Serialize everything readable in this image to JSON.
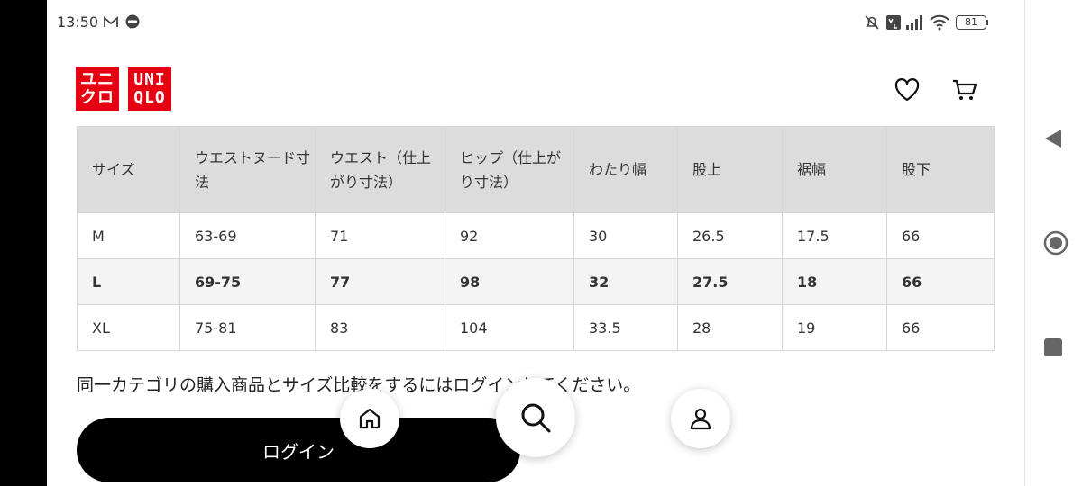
{
  "status_bar": {
    "time": "13:50",
    "battery": "81"
  },
  "brand": {
    "logo_left": [
      "ユニ",
      "クロ"
    ],
    "logo_right": [
      "UNI",
      "QLO"
    ],
    "color": "#e60012"
  },
  "icons": {
    "favorite": "heart-icon",
    "cart": "cart-icon",
    "home": "home-icon",
    "search": "search-icon",
    "account": "user-icon",
    "back": "triangle-back-icon",
    "home_nav": "circle-home-icon",
    "recents": "square-recents-icon"
  },
  "size_table": {
    "headers": [
      "サイズ",
      "ウエストヌード寸法",
      "ウエスト（仕上がり寸法）",
      "ヒップ（仕上がり寸法）",
      "わたり幅",
      "股上",
      "裾幅",
      "股下"
    ],
    "rows": [
      [
        "M",
        "63-69",
        "71",
        "92",
        "30",
        "26.5",
        "17.5",
        "66"
      ],
      [
        "L",
        "69-75",
        "77",
        "98",
        "32",
        "27.5",
        "18",
        "66"
      ],
      [
        "XL",
        "75-81",
        "83",
        "104",
        "33.5",
        "28",
        "19",
        "66"
      ]
    ]
  },
  "note": "同一カテゴリの購入商品とサイズ比較をするにはログインしてください。",
  "login_button": "ログイン"
}
